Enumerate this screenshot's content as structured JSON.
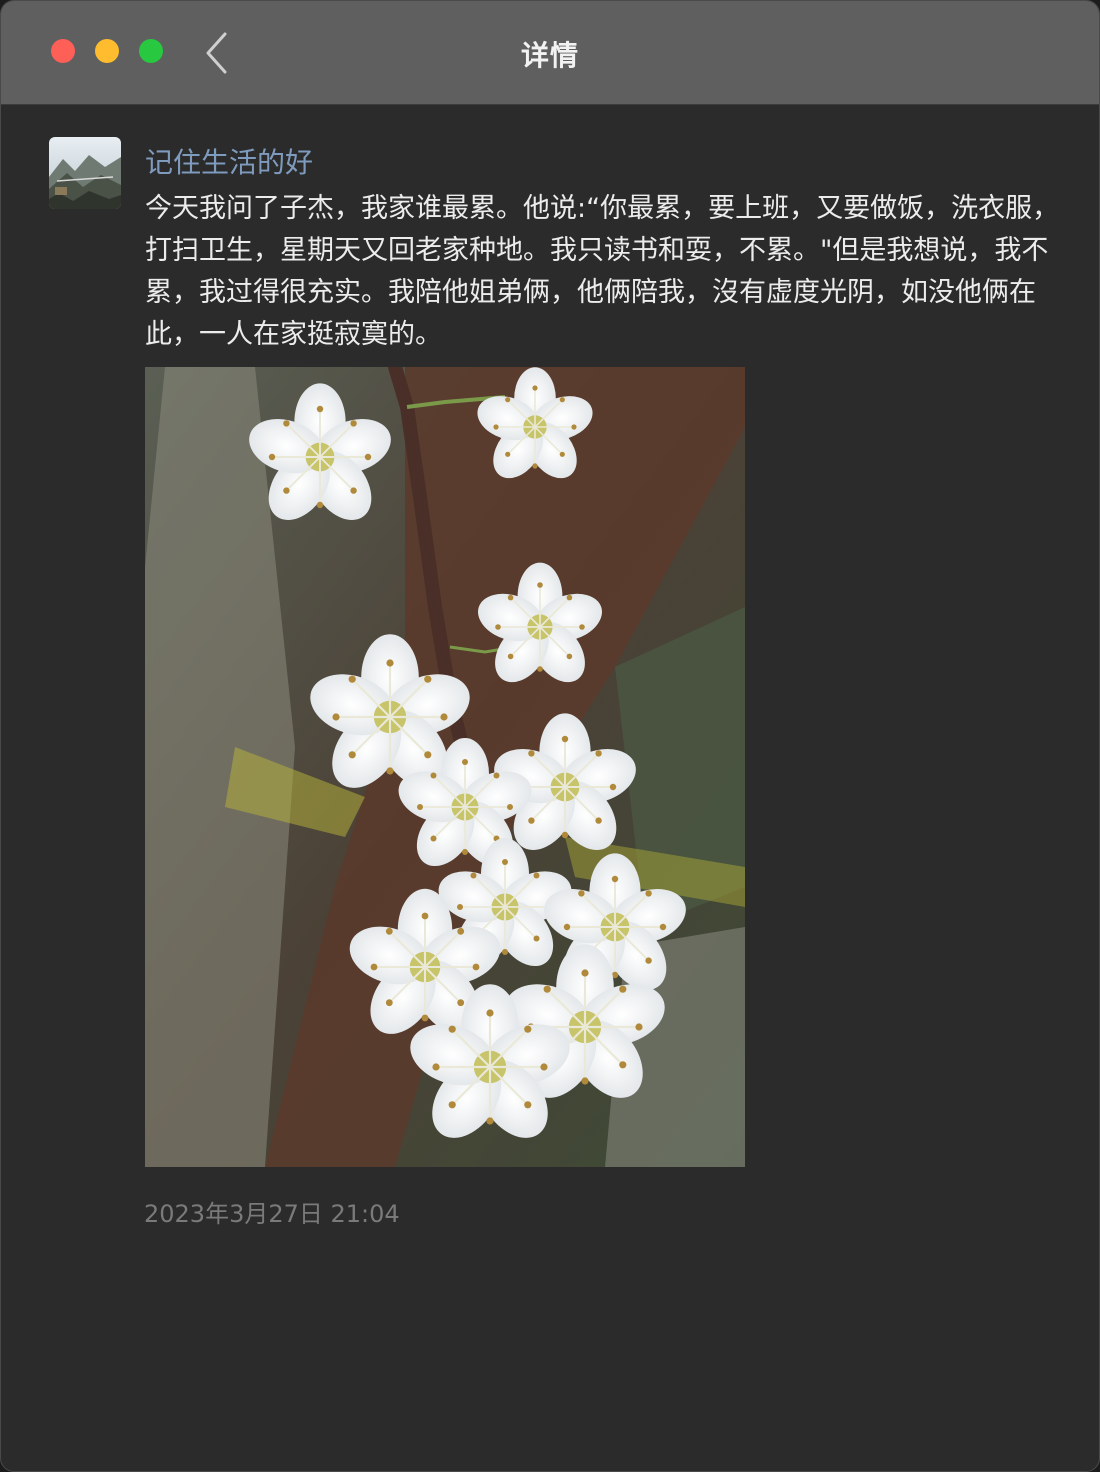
{
  "window": {
    "title": "详情"
  },
  "post": {
    "author": "记住生活的好",
    "text": "今天我问了子杰，我家谁最累。他说:“你最累，要上班，又要做饭，洗衣服，打扫卫生，星期天又回老家种地。我只读书和耍，不累。\"但是我想说，我不累，我过得很充实。我陪他姐弟俩，他俩陪我，沒有虚度光阴，如没他俩在此，一人在家挺寂寞的。",
    "photo_icon": "plum-blossom-photo",
    "timestamp": "2023年3月27日 21:04"
  },
  "colors": {
    "titlebar": "#5f5f5f",
    "background": "#2b2b2b",
    "author": "#7e9bbd",
    "text": "#ececec",
    "timestamp": "#7a7a7a",
    "close": "#fe5f57",
    "minimize": "#febc2e",
    "maximize": "#28c840"
  }
}
